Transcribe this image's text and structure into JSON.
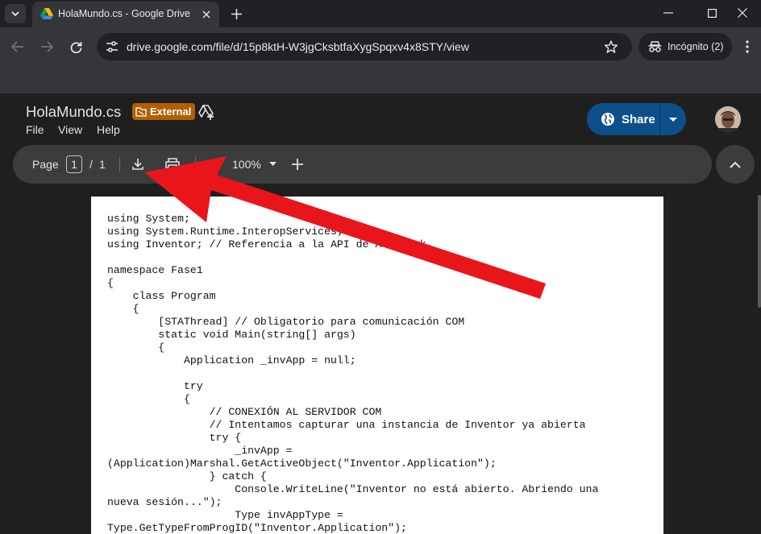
{
  "browser": {
    "tab_title": "HolaMundo.cs - Google Drive",
    "url": "drive.google.com/file/d/15p8ktH-W3jgCksbtfaXygSpqxv4x8STY/view",
    "incognito_label": "Incógnito (2)"
  },
  "drive": {
    "file_title": "HolaMundo.cs",
    "badge": "External",
    "menu": [
      "File",
      "View",
      "Help"
    ],
    "share_label": "Share"
  },
  "viewer": {
    "page_label": "Page",
    "page_current": "1",
    "page_sep": "/",
    "page_total": "1",
    "zoom": "100%"
  },
  "document": {
    "lines": [
      "using System;",
      "using System.Runtime.InteropServices;",
      "using Inventor; // Referencia a la API de Autodesk",
      "",
      "namespace Fase1",
      "{",
      "    class Program",
      "    {",
      "        [STAThread] // Obligatorio para comunicación COM",
      "        static void Main(string[] args)",
      "        {",
      "            Application _invApp = null;",
      "",
      "            try",
      "            {",
      "                // CONEXIÓN AL SERVIDOR COM",
      "                // Intentamos capturar una instancia de Inventor ya abierta",
      "                try {",
      "                    _invApp =",
      "(Application)Marshal.GetActiveObject(\"Inventor.Application\");",
      "                } catch {",
      "                    Console.WriteLine(\"Inventor no está abierto. Abriendo una",
      "nueva sesión...\");",
      "                    Type invAppType =",
      "Type.GetTypeFromProgID(\"Inventor.Application\");"
    ]
  },
  "colors": {
    "annotation_arrow": "#e8161b",
    "share_button": "#0d4f8b",
    "external_badge": "#b06000"
  },
  "icons": [
    "tab-list-icon",
    "drive-favicon",
    "close-icon",
    "new-tab-icon",
    "minimize-icon",
    "maximize-icon",
    "window-close-icon",
    "back-icon",
    "forward-icon",
    "reload-icon",
    "site-info-icon",
    "star-icon",
    "incognito-icon",
    "more-icon",
    "external-badge-icon",
    "add-shortcut-icon",
    "globe-icon",
    "caret-down-icon",
    "download-icon",
    "print-icon",
    "zoom-out-icon",
    "zoom-in-icon",
    "chevron-up-icon"
  ]
}
